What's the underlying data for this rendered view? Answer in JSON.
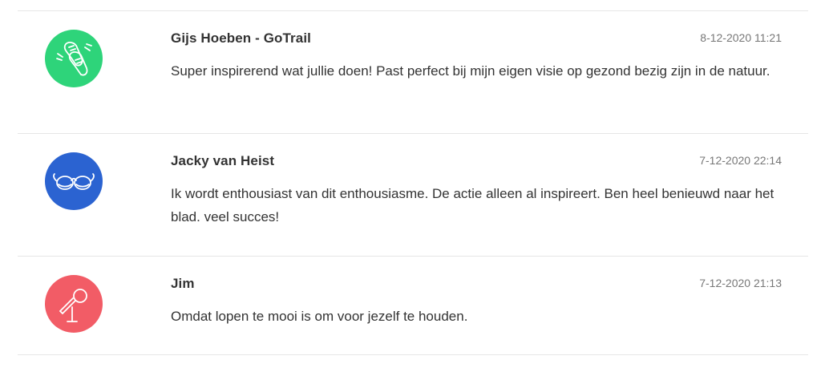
{
  "comments": [
    {
      "author": "Gijs Hoeben - GoTrail",
      "date": "8-12-2020 11:21",
      "text": "Super inspirerend wat jullie doen! Past perfect bij mijn eigen visie op gezond bezig zijn in de natuur.",
      "avatar_icon": "running-shoes-icon",
      "avatar_color": "#2ed47a"
    },
    {
      "author": "Jacky van Heist",
      "date": "7-12-2020 22:14",
      "text": "Ik wordt enthousiast van dit enthousiasme. De actie alleen al inspireert. Ben heel benieuwd naar het blad. veel succes!",
      "avatar_icon": "glasses-icon",
      "avatar_color": "#2b63d1"
    },
    {
      "author": "Jim",
      "date": "7-12-2020 21:13",
      "text": "Omdat lopen te mooi is om voor jezelf te houden.",
      "avatar_icon": "microphone-icon",
      "avatar_color": "#f25c66"
    }
  ]
}
